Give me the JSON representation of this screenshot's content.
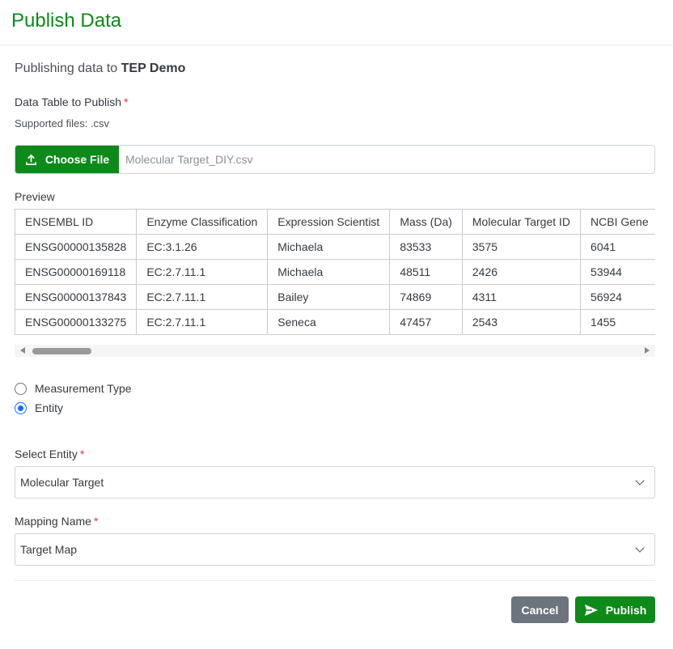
{
  "header": {
    "title": "Publish Data"
  },
  "intro": {
    "prefix": "Publishing data to ",
    "project": "TEP Demo"
  },
  "data_table": {
    "label": "Data Table to Publish",
    "required_mark": "*",
    "supported": "Supported files: .csv",
    "choose_label": "Choose File",
    "file_name": "Molecular Target_DIY.csv"
  },
  "preview": {
    "label": "Preview",
    "columns": [
      "ENSEMBL ID",
      "Enzyme Classification",
      "Expression Scientist",
      "Mass (Da)",
      "Molecular Target ID",
      "NCBI Gene"
    ],
    "rows": [
      [
        "ENSG00000135828",
        "EC:3.1.26",
        "Michaela",
        "83533",
        "3575",
        "6041"
      ],
      [
        "ENSG00000169118",
        "EC:2.7.11.1",
        "Michaela",
        "48511",
        "2426",
        "53944"
      ],
      [
        "ENSG00000137843",
        "EC:2.7.11.1",
        "Bailey",
        "74869",
        "4311",
        "56924"
      ],
      [
        "ENSG00000133275",
        "EC:2.7.11.1",
        "Seneca",
        "47457",
        "2543",
        "1455"
      ]
    ]
  },
  "options": {
    "measurement_type": "Measurement Type",
    "entity": "Entity",
    "selected": "Entity"
  },
  "select_entity": {
    "label": "Select Entity",
    "required_mark": "*",
    "value": "Molecular Target"
  },
  "mapping": {
    "label": "Mapping Name",
    "required_mark": "*",
    "value": "Target Map"
  },
  "actions": {
    "cancel": "Cancel",
    "publish": "Publish"
  },
  "colors": {
    "brand": "#0d8a1a",
    "secondary": "#6c757d",
    "radio": "#0d6efd",
    "required": "#dc3545"
  },
  "icons": {
    "upload": "upload-icon",
    "send": "send-icon",
    "chevron": "chevron-down-icon"
  }
}
